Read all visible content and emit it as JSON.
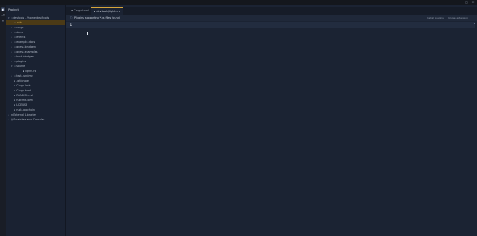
{
  "window": {
    "controls": [
      "—",
      "□",
      "✕"
    ]
  },
  "activity_bar": [
    {
      "name": "project",
      "glyph": "▣",
      "active": true
    },
    {
      "name": "commit",
      "glyph": "⎇",
      "active": false
    },
    {
      "name": "structure",
      "glyph": "≡",
      "active": false
    }
  ],
  "sidebar": {
    "title": "Project",
    "tree": [
      {
        "label": "devtools - /home/dev/tools",
        "indent": 0,
        "chevron": "▾",
        "icon": "▭",
        "selected": false
      },
      {
        "label": ".ssh",
        "indent": 1,
        "chevron": "",
        "icon": "▭",
        "selected": true
      },
      {
        "label": "cargo",
        "indent": 1,
        "chevron": "›",
        "icon": "▭",
        "selected": false
      },
      {
        "label": "docs",
        "indent": 1,
        "chevron": "›",
        "icon": "▭",
        "selected": false
      },
      {
        "label": "events",
        "indent": 1,
        "chevron": "›",
        "icon": "▭",
        "selected": false
      },
      {
        "label": "example-docs",
        "indent": 1,
        "chevron": "›",
        "icon": "▭",
        "selected": false
      },
      {
        "label": "guest-bindgen",
        "indent": 1,
        "chevron": "›",
        "icon": "▭",
        "selected": false
      },
      {
        "label": "guest-examples",
        "indent": 1,
        "chevron": "›",
        "icon": "▭",
        "selected": false
      },
      {
        "label": "host-bindgen",
        "indent": 1,
        "chevron": "›",
        "icon": "▭",
        "selected": false
      },
      {
        "label": "plugins",
        "indent": 1,
        "chevron": "›",
        "icon": "▭",
        "selected": false
      },
      {
        "label": "source",
        "indent": 1,
        "chevron": "▾",
        "icon": "▭",
        "selected": false
      },
      {
        "label": "lights.rs",
        "indent": 2,
        "chevron": "",
        "icon": "▪",
        "selected": false
      },
      {
        "label": "test-runtime",
        "indent": 1,
        "chevron": "›",
        "icon": "▭",
        "selected": false
      },
      {
        "label": ".gitignore",
        "indent": 1,
        "chevron": "",
        "icon": "▪",
        "selected": false
      },
      {
        "label": "Cargo.lock",
        "indent": 1,
        "chevron": "",
        "icon": "▪",
        "selected": false
      },
      {
        "label": "Cargo.toml",
        "indent": 1,
        "chevron": "",
        "icon": "▪",
        "selected": false
      },
      {
        "label": "README.md",
        "indent": 1,
        "chevron": "",
        "icon": "▪",
        "selected": false
      },
      {
        "label": "rustfmt.toml",
        "indent": 1,
        "chevron": "",
        "icon": "▪",
        "selected": false
      },
      {
        "label": "LICENSE",
        "indent": 1,
        "chevron": "",
        "icon": "▪",
        "selected": false
      },
      {
        "label": "rust-toolchain",
        "indent": 1,
        "chevron": "",
        "icon": "▪",
        "selected": false
      },
      {
        "label": "External Libraries",
        "indent": 0,
        "chevron": "›",
        "icon": "▥",
        "selected": false
      },
      {
        "label": "Scratches and Consoles",
        "indent": 0,
        "chevron": "›",
        "icon": "▤",
        "selected": false
      }
    ]
  },
  "editor": {
    "tabs": [
      {
        "label": "Cargo.toml",
        "icon": "▪",
        "active": false
      },
      {
        "label": "devtools/lights.rs",
        "icon": "▪",
        "active": true
      }
    ],
    "breadcrumb": {
      "icon": "ⓘ",
      "text": "Plugins supporting *.rs files found.",
      "actions": [
        "Install plugins",
        "Ignore extension"
      ]
    },
    "line_number": "1"
  }
}
